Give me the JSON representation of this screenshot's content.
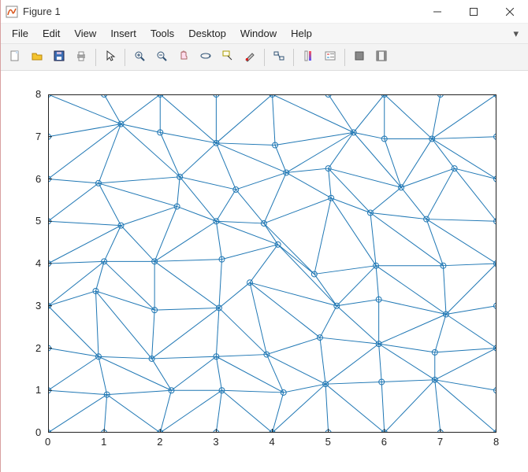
{
  "window": {
    "title": "Figure 1",
    "icon": "matlab-figure-icon"
  },
  "menu": {
    "items": [
      "File",
      "Edit",
      "View",
      "Insert",
      "Tools",
      "Desktop",
      "Window",
      "Help"
    ]
  },
  "toolbar": {
    "new": "New Figure",
    "open": "Open",
    "save": "Save",
    "print": "Print",
    "pointer": "Edit Plot",
    "zoom_in": "Zoom In",
    "zoom_out": "Zoom Out",
    "pan": "Pan",
    "rotate": "Rotate 3D",
    "data_cursor": "Data Cursor",
    "brush": "Brush",
    "link": "Link Plot",
    "colorbar": "Insert Colorbar",
    "legend": "Insert Legend",
    "hide": "Hide Plot Tools",
    "show": "Show Plot Tools"
  },
  "chart_data": {
    "type": "scatter",
    "title": "",
    "xlabel": "",
    "ylabel": "",
    "xlim": [
      0,
      8
    ],
    "ylim": [
      0,
      8
    ],
    "xticks": [
      0,
      1,
      2,
      3,
      4,
      5,
      6,
      7,
      8
    ],
    "yticks": [
      0,
      1,
      2,
      3,
      4,
      5,
      6,
      7,
      8
    ],
    "nodes": [
      [
        0,
        0
      ],
      [
        1,
        0
      ],
      [
        2,
        0
      ],
      [
        3,
        0
      ],
      [
        4,
        0
      ],
      [
        5,
        0
      ],
      [
        6,
        0
      ],
      [
        7,
        0
      ],
      [
        8,
        0
      ],
      [
        0,
        1
      ],
      [
        1.05,
        0.9
      ],
      [
        2.2,
        1.0
      ],
      [
        3.1,
        1.0
      ],
      [
        4.2,
        0.95
      ],
      [
        4.95,
        1.15
      ],
      [
        5.95,
        1.2
      ],
      [
        6.9,
        1.25
      ],
      [
        8,
        1
      ],
      [
        0,
        2
      ],
      [
        0.9,
        1.8
      ],
      [
        1.85,
        1.75
      ],
      [
        3.0,
        1.8
      ],
      [
        3.9,
        1.85
      ],
      [
        4.85,
        2.25
      ],
      [
        5.9,
        2.1
      ],
      [
        6.9,
        1.9
      ],
      [
        8,
        2
      ],
      [
        0,
        3
      ],
      [
        0.85,
        3.35
      ],
      [
        1.9,
        2.9
      ],
      [
        3.05,
        2.95
      ],
      [
        3.6,
        3.55
      ],
      [
        5.15,
        3.0
      ],
      [
        5.9,
        3.15
      ],
      [
        7.1,
        2.8
      ],
      [
        8,
        3
      ],
      [
        0,
        4
      ],
      [
        1.0,
        4.05
      ],
      [
        1.9,
        4.05
      ],
      [
        3.1,
        4.1
      ],
      [
        4.1,
        4.45
      ],
      [
        4.75,
        3.75
      ],
      [
        5.85,
        3.95
      ],
      [
        7.05,
        3.95
      ],
      [
        8,
        4
      ],
      [
        0,
        5
      ],
      [
        1.3,
        4.9
      ],
      [
        2.3,
        5.35
      ],
      [
        3.0,
        5.0
      ],
      [
        3.85,
        4.95
      ],
      [
        5.05,
        5.55
      ],
      [
        5.75,
        5.2
      ],
      [
        6.75,
        5.05
      ],
      [
        8,
        5
      ],
      [
        0,
        6
      ],
      [
        0.9,
        5.9
      ],
      [
        2.35,
        6.05
      ],
      [
        3.35,
        5.75
      ],
      [
        4.25,
        6.15
      ],
      [
        5.0,
        6.25
      ],
      [
        6.3,
        5.8
      ],
      [
        7.25,
        6.25
      ],
      [
        8,
        6
      ],
      [
        0,
        7
      ],
      [
        1.3,
        7.3
      ],
      [
        2.0,
        7.1
      ],
      [
        3.0,
        6.85
      ],
      [
        4.05,
        6.8
      ],
      [
        5.45,
        7.1
      ],
      [
        6.0,
        6.95
      ],
      [
        6.85,
        6.95
      ],
      [
        8,
        7
      ],
      [
        0,
        8
      ],
      [
        1,
        8
      ],
      [
        2,
        8
      ],
      [
        3,
        8
      ],
      [
        4,
        8
      ],
      [
        5,
        8
      ],
      [
        6,
        8
      ],
      [
        7,
        8
      ],
      [
        8,
        8
      ]
    ],
    "edges": [
      [
        0,
        1
      ],
      [
        1,
        2
      ],
      [
        2,
        3
      ],
      [
        3,
        4
      ],
      [
        4,
        5
      ],
      [
        5,
        6
      ],
      [
        6,
        7
      ],
      [
        7,
        8
      ],
      [
        9,
        10
      ],
      [
        10,
        11
      ],
      [
        11,
        12
      ],
      [
        12,
        13
      ],
      [
        13,
        14
      ],
      [
        14,
        15
      ],
      [
        15,
        16
      ],
      [
        16,
        17
      ],
      [
        18,
        19
      ],
      [
        19,
        20
      ],
      [
        20,
        21
      ],
      [
        21,
        22
      ],
      [
        22,
        23
      ],
      [
        23,
        24
      ],
      [
        24,
        25
      ],
      [
        25,
        26
      ],
      [
        27,
        28
      ],
      [
        28,
        29
      ],
      [
        29,
        30
      ],
      [
        30,
        31
      ],
      [
        31,
        32
      ],
      [
        32,
        33
      ],
      [
        33,
        34
      ],
      [
        34,
        35
      ],
      [
        36,
        37
      ],
      [
        37,
        38
      ],
      [
        38,
        39
      ],
      [
        39,
        40
      ],
      [
        40,
        41
      ],
      [
        41,
        42
      ],
      [
        42,
        43
      ],
      [
        43,
        44
      ],
      [
        45,
        46
      ],
      [
        46,
        47
      ],
      [
        47,
        48
      ],
      [
        48,
        49
      ],
      [
        49,
        50
      ],
      [
        50,
        51
      ],
      [
        51,
        52
      ],
      [
        52,
        53
      ],
      [
        54,
        55
      ],
      [
        55,
        56
      ],
      [
        56,
        57
      ],
      [
        57,
        58
      ],
      [
        58,
        59
      ],
      [
        59,
        60
      ],
      [
        60,
        61
      ],
      [
        61,
        62
      ],
      [
        63,
        64
      ],
      [
        64,
        65
      ],
      [
        65,
        66
      ],
      [
        66,
        67
      ],
      [
        67,
        68
      ],
      [
        68,
        69
      ],
      [
        69,
        70
      ],
      [
        70,
        71
      ],
      [
        72,
        73
      ],
      [
        73,
        74
      ],
      [
        74,
        75
      ],
      [
        75,
        76
      ],
      [
        76,
        77
      ],
      [
        77,
        78
      ],
      [
        78,
        79
      ],
      [
        79,
        80
      ],
      [
        0,
        9
      ],
      [
        9,
        18
      ],
      [
        18,
        27
      ],
      [
        27,
        36
      ],
      [
        36,
        45
      ],
      [
        45,
        54
      ],
      [
        54,
        63
      ],
      [
        63,
        72
      ],
      [
        8,
        17
      ],
      [
        17,
        26
      ],
      [
        26,
        35
      ],
      [
        35,
        44
      ],
      [
        44,
        53
      ],
      [
        53,
        62
      ],
      [
        62,
        71
      ],
      [
        71,
        80
      ],
      [
        1,
        10
      ],
      [
        2,
        11
      ],
      [
        3,
        12
      ],
      [
        4,
        13
      ],
      [
        5,
        14
      ],
      [
        6,
        15
      ],
      [
        7,
        16
      ],
      [
        10,
        19
      ],
      [
        11,
        20
      ],
      [
        12,
        21
      ],
      [
        13,
        22
      ],
      [
        14,
        23
      ],
      [
        15,
        24
      ],
      [
        16,
        25
      ],
      [
        19,
        28
      ],
      [
        20,
        29
      ],
      [
        21,
        30
      ],
      [
        22,
        31
      ],
      [
        23,
        32
      ],
      [
        24,
        33
      ],
      [
        25,
        34
      ],
      [
        28,
        37
      ],
      [
        29,
        38
      ],
      [
        30,
        39
      ],
      [
        31,
        40
      ],
      [
        32,
        41
      ],
      [
        33,
        42
      ],
      [
        34,
        43
      ],
      [
        37,
        46
      ],
      [
        38,
        47
      ],
      [
        39,
        48
      ],
      [
        40,
        49
      ],
      [
        41,
        50
      ],
      [
        42,
        51
      ],
      [
        43,
        52
      ],
      [
        46,
        55
      ],
      [
        47,
        56
      ],
      [
        48,
        57
      ],
      [
        49,
        58
      ],
      [
        50,
        59
      ],
      [
        51,
        60
      ],
      [
        52,
        61
      ],
      [
        55,
        64
      ],
      [
        56,
        65
      ],
      [
        57,
        66
      ],
      [
        58,
        67
      ],
      [
        59,
        68
      ],
      [
        60,
        69
      ],
      [
        61,
        70
      ],
      [
        64,
        73
      ],
      [
        65,
        74
      ],
      [
        66,
        75
      ],
      [
        67,
        76
      ],
      [
        68,
        77
      ],
      [
        69,
        78
      ],
      [
        70,
        79
      ],
      [
        0,
        10
      ],
      [
        2,
        10
      ],
      [
        2,
        12
      ],
      [
        4,
        12
      ],
      [
        4,
        14
      ],
      [
        6,
        14
      ],
      [
        6,
        16
      ],
      [
        8,
        16
      ],
      [
        9,
        19
      ],
      [
        11,
        19
      ],
      [
        11,
        21
      ],
      [
        13,
        21
      ],
      [
        14,
        22
      ],
      [
        14,
        24
      ],
      [
        16,
        24
      ],
      [
        16,
        26
      ],
      [
        19,
        27
      ],
      [
        20,
        28
      ],
      [
        20,
        30
      ],
      [
        22,
        30
      ],
      [
        23,
        31
      ],
      [
        24,
        32
      ],
      [
        24,
        34
      ],
      [
        26,
        34
      ],
      [
        27,
        37
      ],
      [
        29,
        37
      ],
      [
        30,
        38
      ],
      [
        32,
        40
      ],
      [
        32,
        42
      ],
      [
        34,
        42
      ],
      [
        34,
        44
      ],
      [
        36,
        46
      ],
      [
        38,
        46
      ],
      [
        38,
        48
      ],
      [
        40,
        48
      ],
      [
        41,
        49
      ],
      [
        42,
        50
      ],
      [
        43,
        51
      ],
      [
        44,
        52
      ],
      [
        45,
        55
      ],
      [
        47,
        55
      ],
      [
        48,
        56
      ],
      [
        49,
        57
      ],
      [
        50,
        58
      ],
      [
        51,
        59
      ],
      [
        52,
        60
      ],
      [
        53,
        61
      ],
      [
        54,
        64
      ],
      [
        56,
        64
      ],
      [
        56,
        66
      ],
      [
        58,
        66
      ],
      [
        58,
        68
      ],
      [
        60,
        68
      ],
      [
        60,
        70
      ],
      [
        62,
        70
      ],
      [
        64,
        72
      ],
      [
        64,
        74
      ],
      [
        66,
        74
      ],
      [
        66,
        76
      ],
      [
        68,
        76
      ],
      [
        68,
        78
      ],
      [
        70,
        78
      ],
      [
        70,
        80
      ]
    ],
    "node_marker": "circle",
    "color": "#1f77b4"
  }
}
